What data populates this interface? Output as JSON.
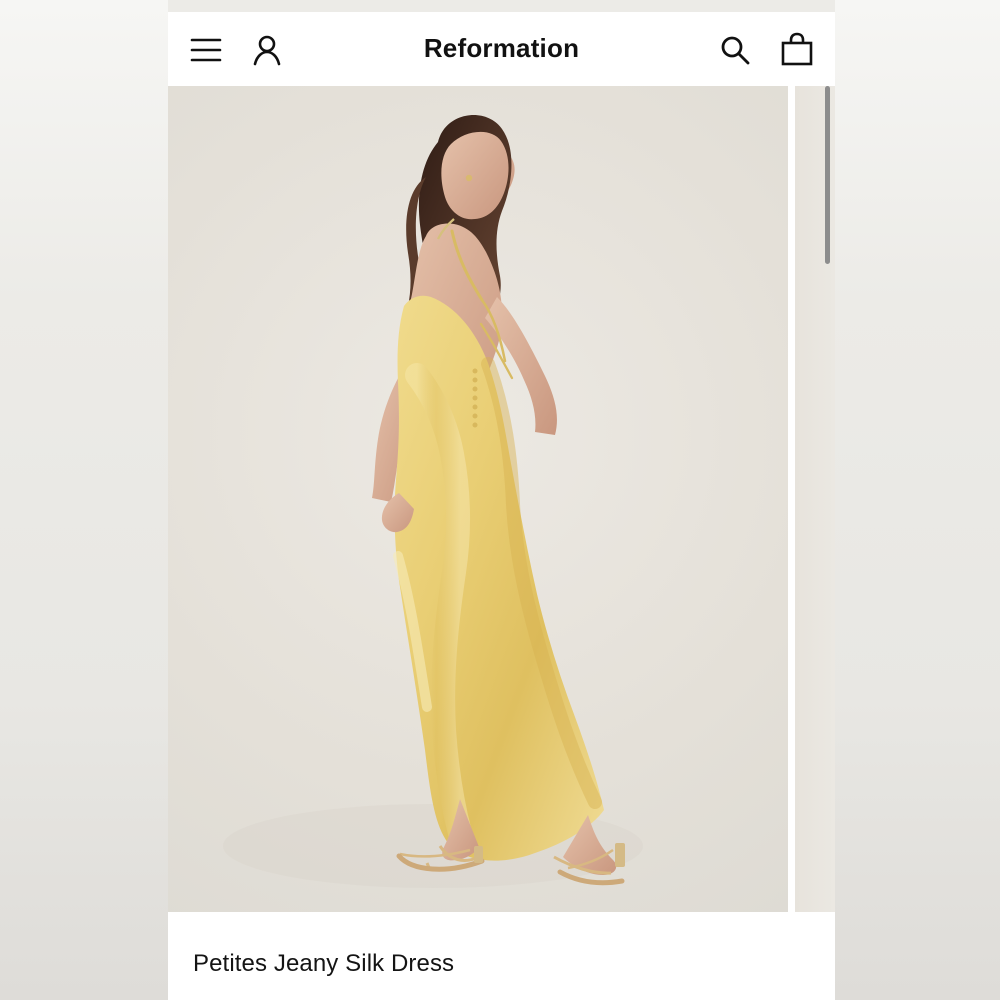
{
  "brand": {
    "name": "Reformation"
  },
  "header": {
    "icons": {
      "menu": "menu-icon",
      "account": "account-icon",
      "search": "search-icon",
      "bag": "bag-icon"
    }
  },
  "product": {
    "title": "Petites Jeany Silk Dress"
  },
  "colors": {
    "background": "#ffffff",
    "text": "#111111",
    "photo_backdrop": "#e7e3dc",
    "dress_gold": "#e2c66b",
    "skin": "#d8b098",
    "hair": "#4b2f22"
  }
}
